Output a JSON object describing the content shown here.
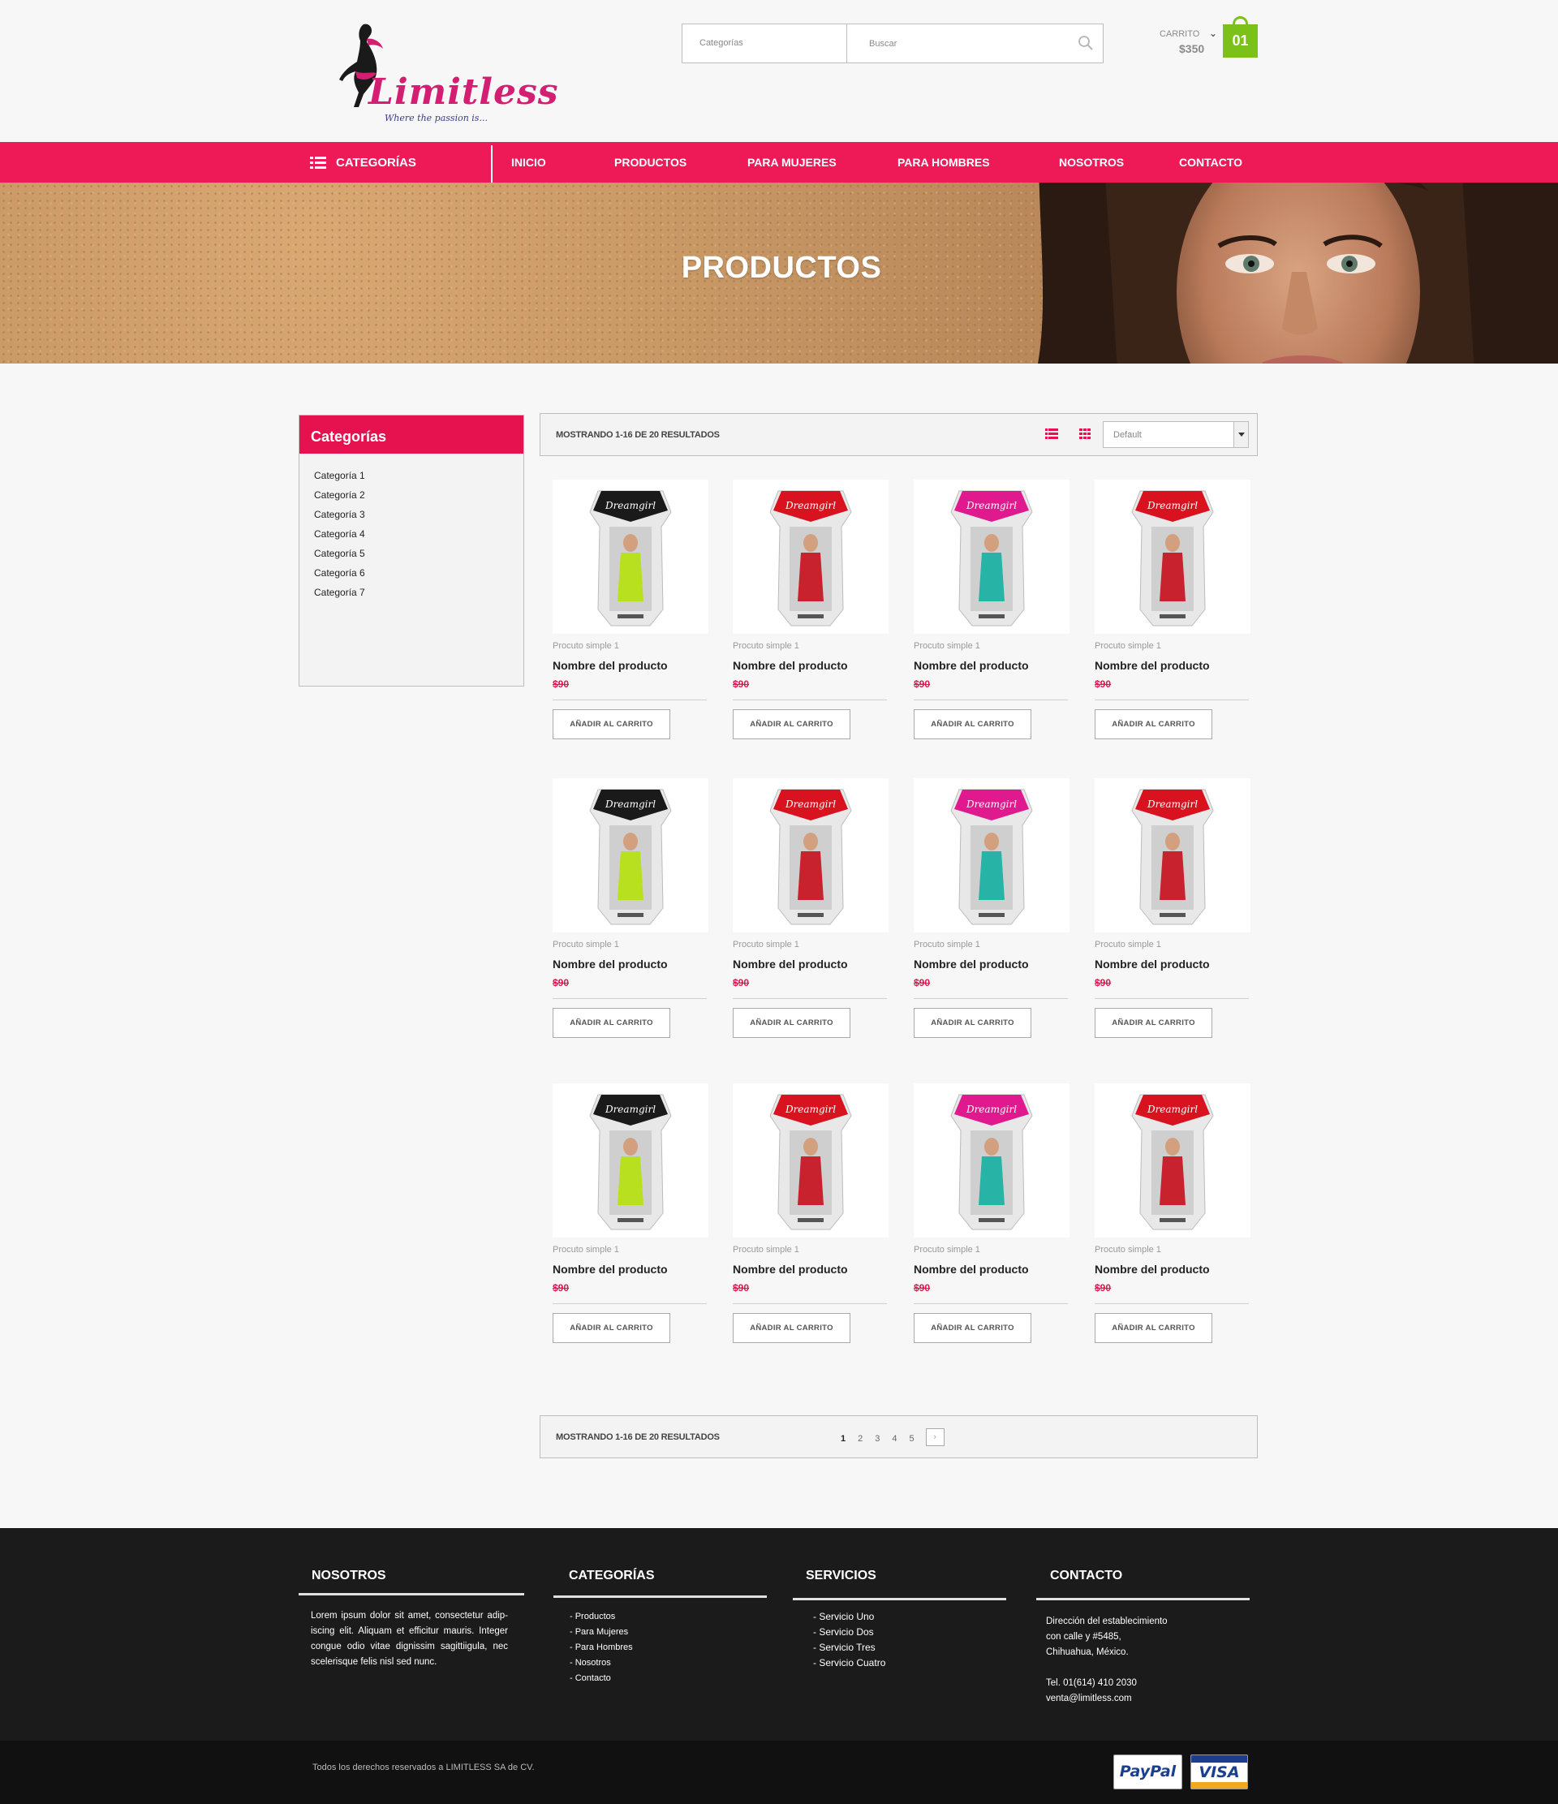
{
  "brand": {
    "logo_text": "Limitless",
    "tagline": "Where the passion is..."
  },
  "search": {
    "category_label": "Categorías",
    "placeholder": "Buscar"
  },
  "cart": {
    "label": "CARRITO",
    "total": "$350",
    "count": "01"
  },
  "nav": {
    "categories_label": "CATEGORÍAS",
    "items": [
      "INICIO",
      "PRODUCTOS",
      "PARA MUJERES",
      "PARA HOMBRES",
      "NOSOTROS",
      "CONTACTO"
    ]
  },
  "hero": {
    "title": "PRODUCTOS"
  },
  "sidebar": {
    "title": "Categorías",
    "items": [
      "Categoría 1",
      "Categoría 2",
      "Categoría 3",
      "Categoría 4",
      "Categoría 5",
      "Categoría 6",
      "Categoría 7"
    ]
  },
  "toolbar": {
    "results_text": "MOSTRANDO 1-16 DE 20 RESULTADOS",
    "sort_value": "Default"
  },
  "products": [
    {
      "subtitle": "Procuto simple 1",
      "name": "Nombre del producto",
      "price": "$90",
      "button": "AÑADIR AL CARRITO",
      "color": "#1a1a1a"
    },
    {
      "subtitle": "Procuto simple 1",
      "name": "Nombre del producto",
      "price": "$90",
      "button": "AÑADIR AL CARRITO",
      "color": "#d8131f"
    },
    {
      "subtitle": "Procuto simple 1",
      "name": "Nombre del producto",
      "price": "$90",
      "button": "AÑADIR AL CARRITO",
      "color": "#e01a8e"
    },
    {
      "subtitle": "Procuto simple 1",
      "name": "Nombre del producto",
      "price": "$90",
      "button": "AÑADIR AL CARRITO",
      "color": "#d8131f"
    },
    {
      "subtitle": "Procuto simple 1",
      "name": "Nombre del producto",
      "price": "$90",
      "button": "AÑADIR AL CARRITO",
      "color": "#1a1a1a"
    },
    {
      "subtitle": "Procuto simple 1",
      "name": "Nombre del producto",
      "price": "$90",
      "button": "AÑADIR AL CARRITO",
      "color": "#d8131f"
    },
    {
      "subtitle": "Procuto simple 1",
      "name": "Nombre del producto",
      "price": "$90",
      "button": "AÑADIR AL CARRITO",
      "color": "#e01a8e"
    },
    {
      "subtitle": "Procuto simple 1",
      "name": "Nombre del producto",
      "price": "$90",
      "button": "AÑADIR AL CARRITO",
      "color": "#d8131f"
    },
    {
      "subtitle": "Procuto simple 1",
      "name": "Nombre del producto",
      "price": "$90",
      "button": "AÑADIR AL CARRITO",
      "color": "#1a1a1a"
    },
    {
      "subtitle": "Procuto simple 1",
      "name": "Nombre del producto",
      "price": "$90",
      "button": "AÑADIR AL CARRITO",
      "color": "#d8131f"
    },
    {
      "subtitle": "Procuto simple 1",
      "name": "Nombre del producto",
      "price": "$90",
      "button": "AÑADIR AL CARRITO",
      "color": "#e01a8e"
    },
    {
      "subtitle": "Procuto simple 1",
      "name": "Nombre del producto",
      "price": "$90",
      "button": "AÑADIR AL CARRITO",
      "color": "#d8131f"
    }
  ],
  "pagination": {
    "results_text": "MOSTRANDO 1-16 DE 20 RESULTADOS",
    "pages": [
      "1",
      "2",
      "3",
      "4",
      "5"
    ],
    "next": "›"
  },
  "footer": {
    "about": {
      "title": "NOSOTROS",
      "text": "Lorem ipsum dolor sit amet, consectetur adip-iscing elit. Aliquam et efficitur mauris. Integer congue odio vitae dignissim sagittiigula, nec scelerisque felis nisl sed nunc."
    },
    "categories": {
      "title": "CATEGORÍAS",
      "items": [
        "- Productos",
        "- Para Mujeres",
        "- Para Hombres",
        "- Nosotros",
        "- Contacto"
      ]
    },
    "services": {
      "title": "SERVICIOS",
      "items": [
        "- Servicio  Uno",
        "- Servicio Dos",
        "- Servicio Tres",
        "- Servicio Cuatro"
      ]
    },
    "contact": {
      "title": "CONTACTO",
      "address_1": "Dirección del establecimiento",
      "address_2": "con calle  y #5485,",
      "address_3": "Chihuahua, México.",
      "phone": "Tel. 01(614) 410 2030",
      "email": "venta@limitless.com"
    },
    "copyright": "Todos los derechos reservados a LIMITLESS SA de CV.",
    "payments": {
      "paypal": "PayPal",
      "visa": "VISA"
    }
  },
  "colors": {
    "accent": "#ee1a58",
    "cart": "#7cc11a",
    "price": "#e6124f"
  },
  "icons": [
    "logo-silhouette",
    "search-icon",
    "chevron-down-icon",
    "list-icon",
    "list-view-icon",
    "grid-view-icon"
  ]
}
